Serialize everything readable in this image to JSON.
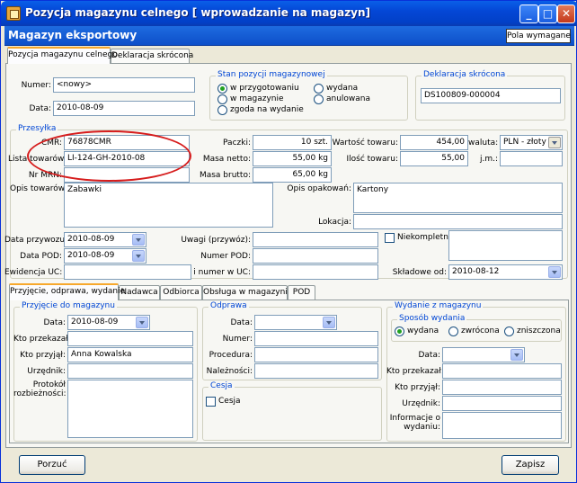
{
  "window": {
    "title": "Pozycja magazynu celnego [ wprowadzanie na magazyn]"
  },
  "header": {
    "title": "Magazyn eksportowy",
    "required_fields_button": "Pola wymagane"
  },
  "top_tabs": [
    "Pozycja magazynu celnego",
    "Deklaracja skrócona"
  ],
  "form": {
    "numer_label": "Numer:",
    "numer_value": "<nowy>",
    "data_label": "Data:",
    "data_value": "2010-08-09"
  },
  "stan": {
    "legend": "Stan pozycji magazynowej",
    "options": [
      "w przygotowaniu",
      "w magazynie",
      "zgoda na wydanie",
      "wydana",
      "anulowana"
    ],
    "selected": "w przygotowaniu"
  },
  "deklaracja": {
    "legend": "Deklaracja skrócona",
    "value": "DS100809-000004"
  },
  "przesylka": {
    "legend": "Przesyłka",
    "cmr_label": "CMR:",
    "cmr_value": "76878CMR",
    "lista_label": "Lista towarów:",
    "lista_value": "LI-124-GH-2010-08",
    "mrn_label": "Nr MRN:",
    "mrn_value": "",
    "paczki_label": "Paczki:",
    "paczki_value": "10 szt.",
    "netto_label": "Masa netto:",
    "netto_value": "55,00 kg",
    "brutto_label": "Masa brutto:",
    "brutto_value": "65,00 kg",
    "wartosc_label": "Wartość towaru:",
    "wartosc_value": "454,00",
    "waluta_label": "waluta:",
    "waluta_value": "PLN - złoty",
    "ilosc_label": "Ilość towaru:",
    "ilosc_value": "55,00",
    "jm_label": "j.m.:",
    "jm_value": "",
    "opis_label": "Opis towarów:",
    "opis_value": "Zabawki",
    "opak_label": "Opis opakowań:",
    "opak_value": "Kartony",
    "lokacja_label": "Lokacja:",
    "lokacja_value": "",
    "data_przywozu_label": "Data przywozu:",
    "data_przywozu_value": "2010-08-09",
    "data_pod_label": "Data POD:",
    "data_pod_value": "2010-08-09",
    "ewidencja_label": "Ewidencja UC:",
    "ewidencja_value": "",
    "uwagi_label": "Uwagi (przywóz):",
    "uwagi_value": "",
    "numer_pod_label": "Numer POD:",
    "numer_pod_value": "",
    "numer_uc_label": "i numer w UC:",
    "numer_uc_value": "",
    "niekompletna_label": "Niekompletna",
    "skladowe_label": "Składowe od:",
    "skladowe_value": "2010-08-12"
  },
  "bottom_tabs": [
    "Przyjęcie, odprawa, wydanie",
    "Nadawca",
    "Odbiorca",
    "Obsługa w magazynie",
    "POD"
  ],
  "przyjecie": {
    "legend": "Przyjęcie do magazynu",
    "data_label": "Data:",
    "data_value": "2010-08-09",
    "przekazal_label": "Kto przekazał:",
    "przekazal_value": "",
    "przyjal_label": "Kto przyjął:",
    "przyjal_value": "Anna Kowalska",
    "urzednik_label": "Urzędnik:",
    "urzednik_value": "",
    "protokol_label_1": "Protokół",
    "protokol_label_2": "rozbieżności:"
  },
  "odprawa": {
    "legend": "Odprawa",
    "data_label": "Data:",
    "numer_label": "Numer:",
    "procedura_label": "Procedura:",
    "naleznosci_label": "Należności:"
  },
  "cesja": {
    "legend": "Cesja",
    "label": "Cesja"
  },
  "wydanie": {
    "legend": "Wydanie z magazynu",
    "sposob_legend": "Sposób wydania",
    "options": [
      "wydana",
      "zwrócona",
      "zniszczona"
    ],
    "selected": "wydana",
    "data_label": "Data:",
    "przekazal_label": "Kto przekazał:",
    "przyjal_label": "Kto przyjął:",
    "urzednik_label": "Urzędnik:",
    "info_label_1": "Informacje o",
    "info_label_2": "wydaniu:"
  },
  "buttons": {
    "cancel": "Porzuć",
    "save": "Zapisz"
  },
  "colors": {
    "title_bar": "#0447d6",
    "annotation": "#d61c1c",
    "accent_tab": "#f7a82c"
  }
}
